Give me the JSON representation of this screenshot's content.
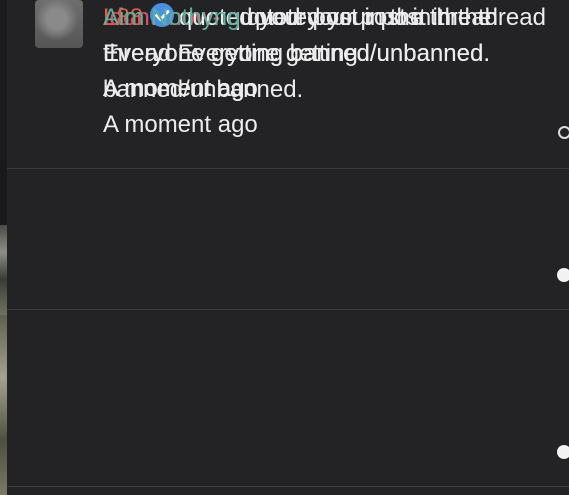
{
  "notifications": [
    {
      "username": "Idontknow-",
      "username_color": "#e0506a",
      "verified": false,
      "message": " quoted your post in the thread Everyone getting banned/unbanned.",
      "time": "A moment ago",
      "read_indicator": "unread-outline-dot",
      "avatar": "user-avatar-photo"
    },
    {
      "username": "L88",
      "username_color": "#e05a45",
      "verified": true,
      "verified_icon": "verified-badge-icon",
      "message": "quoted your post in the thread Everyone getting banned/unbanned.",
      "time": "A moment ago",
      "read_indicator": "read-filled-dot",
      "avatar": "user-avatar-photo"
    },
    {
      "username": "Aim Nothyng",
      "username_color": "#5fae9c",
      "verified": false,
      "message": " quoted your post in the thread Everyone getting banned/unbanned.",
      "time": "A moment ago",
      "read_indicator": "read-filled-dot",
      "avatar": "user-avatar-placeholder"
    }
  ],
  "colors": {
    "background": "#232325",
    "text": "#ececec",
    "divider": "#3a3a3c",
    "verified_badge": "#4a90e2"
  }
}
